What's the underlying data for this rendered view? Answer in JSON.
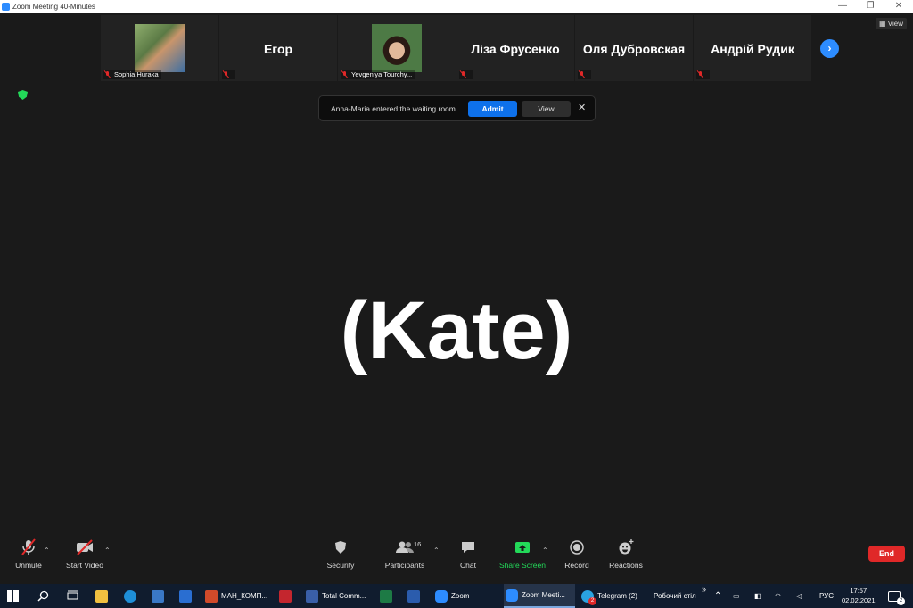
{
  "window": {
    "title": "Zoom Meeting 40-Minutes",
    "minimize": "—",
    "restore": "❐",
    "close": "✕"
  },
  "top_right": {
    "view_label": "View"
  },
  "participants_strip": [
    {
      "kind": "photo",
      "label": "Sophia Huraka",
      "photo_color": "#6a8b5a"
    },
    {
      "kind": "name",
      "name": "Егор"
    },
    {
      "kind": "photo",
      "label": "Yevgeniya Tourchy...",
      "photo_color": "#3c5f3a"
    },
    {
      "kind": "name",
      "name": "Ліза Фрусенко"
    },
    {
      "kind": "name",
      "name": "Оля Дубровская"
    },
    {
      "kind": "name",
      "name": "Андрій Рудик"
    }
  ],
  "notification": {
    "message": "Anna-Maria entered the waiting room",
    "admit": "Admit",
    "view": "View",
    "close": "✕"
  },
  "active_speaker": "(Kate)",
  "toolbar": {
    "unmute": "Unmute",
    "start_video": "Start Video",
    "security": "Security",
    "participants": "Participants",
    "participants_count": "16",
    "chat": "Chat",
    "share_screen": "Share Screen",
    "record": "Record",
    "reactions": "Reactions",
    "end": "End"
  },
  "taskbar": {
    "apps": [
      "МАН_КОМП...",
      "Total Comm...",
      "Zoom",
      "Zoom Meeti...",
      "Telegram (2)"
    ],
    "telegram_badge": "2",
    "desktop_label": "Робочий стіл",
    "lang": "РУС",
    "time": "17:57",
    "date": "02.02.2021",
    "notif_count": "2"
  },
  "colors": {
    "accent": "#2d8cff",
    "end": "#e02828",
    "share": "#23d959",
    "bg": "#1a1a1a"
  }
}
